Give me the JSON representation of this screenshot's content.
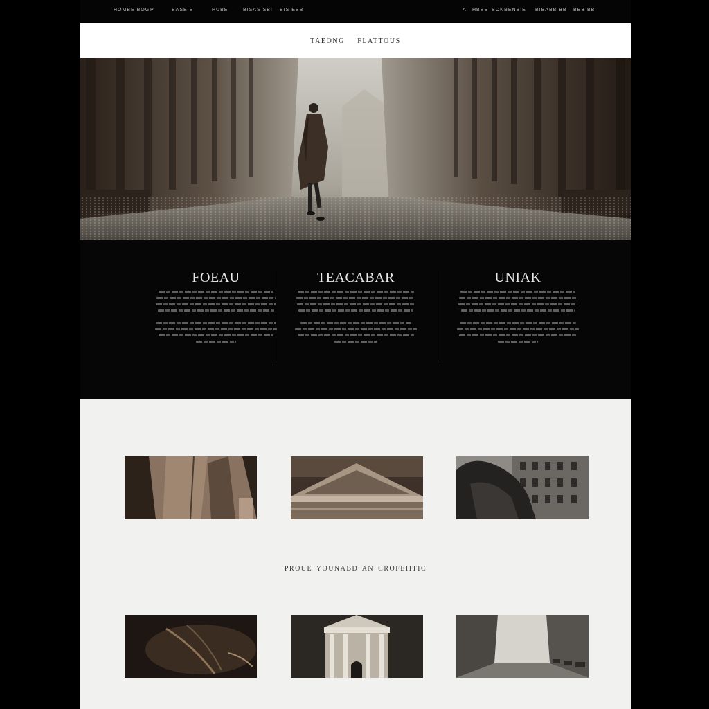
{
  "nav": {
    "left": [
      "HOMBE BOG",
      "P",
      "BASEIE",
      "HUBE",
      "BISAS SBI",
      "BIS EBB"
    ],
    "right": [
      "A",
      "HBBS",
      "BONBENBIE",
      "BIBABB BB",
      "BBB BB"
    ]
  },
  "header": {
    "brand_first": "TAEONG",
    "brand_second": "FLATTOUS"
  },
  "hero": {
    "image": "man-in-coat-walking-foggy-colonnade-street"
  },
  "columns": [
    {
      "title": "FOEAU"
    },
    {
      "title": "TEACABAR"
    },
    {
      "title": "UNIAK"
    }
  ],
  "gallery": {
    "row1": [
      {
        "image": "coat-closeup"
      },
      {
        "image": "classical-pediment"
      },
      {
        "image": "hooded-figure-city"
      }
    ],
    "tagline": "PROUE YOUNABD AN CROFEIITIC",
    "row2": [
      {
        "image": "dark-texture"
      },
      {
        "image": "classical-building"
      },
      {
        "image": "foggy-street"
      }
    ]
  },
  "colors": {
    "page_background": "#000000",
    "header_band": "#ffffff",
    "gallery_background": "#f1f1f0",
    "column_title": "#e8e8e8"
  }
}
